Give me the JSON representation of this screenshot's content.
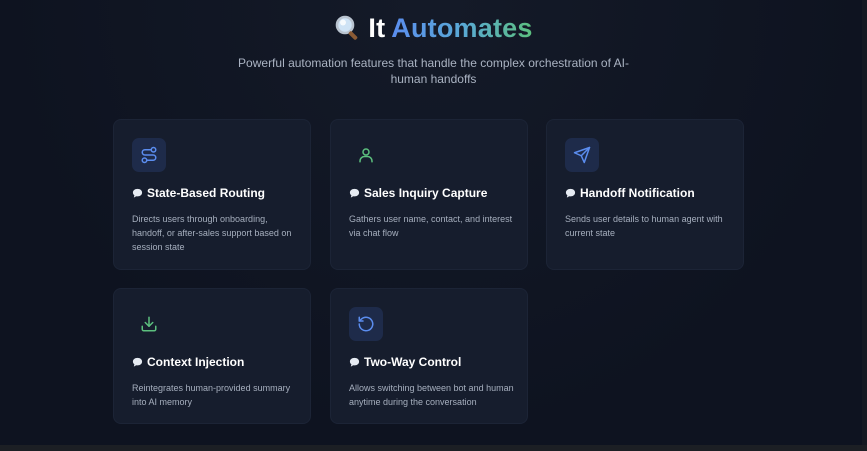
{
  "header": {
    "title_emoji": "🔍",
    "title_plain": "It",
    "title_highlight": "Automates",
    "subtitle": "Powerful automation features that handle the complex orchestration of AI-human handoffs"
  },
  "colors": {
    "background": "#0e1320",
    "card": "#161d2d",
    "accent_blue": "#5b8def",
    "accent_green": "#5cc07e"
  },
  "cards": [
    {
      "icon": "route-icon",
      "title": "State-Based Routing",
      "description": "Directs users through onboarding, handoff, or after-sales support based on session state"
    },
    {
      "icon": "user-icon",
      "title": "Sales Inquiry Capture",
      "description": "Gathers user name, contact, and interest via chat flow"
    },
    {
      "icon": "send-icon",
      "title": "Handoff Notification",
      "description": "Sends user details to human agent with current state"
    },
    {
      "icon": "download-icon",
      "title": "Context Injection",
      "description": "Reintegrates human-provided summary into AI memory"
    },
    {
      "icon": "rotate-icon",
      "title": "Two-Way Control",
      "description": "Allows switching between bot and human anytime during the conversation"
    }
  ]
}
